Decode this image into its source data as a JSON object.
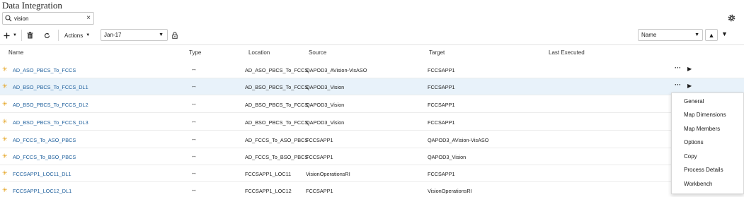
{
  "page": {
    "title": "Data Integration"
  },
  "search": {
    "value": "vision",
    "clear_label": "×"
  },
  "toolbar": {
    "actions_label": "Actions",
    "period_value": "Jan-17",
    "sort_value": "Name"
  },
  "columns": {
    "name": "Name",
    "type": "Type",
    "location": "Location",
    "source": "Source",
    "target": "Target",
    "last_executed": "Last Executed"
  },
  "rows": [
    {
      "name": "AD_ASO_PBCS_To_FCCS",
      "type": "↔",
      "location": "AD_ASO_PBCS_To_FCCS",
      "source": "QAPOD3_AVision-VisASO",
      "target": "FCCSAPP1",
      "last_executed": ""
    },
    {
      "name": "AD_BSO_PBCS_To_FCCS_DL1",
      "type": "↔",
      "location": "AD_BSO_PBCS_To_FCCS",
      "source": "QAPOD3_Vision",
      "target": "FCCSAPP1",
      "last_executed": ""
    },
    {
      "name": "AD_BSO_PBCS_To_FCCS_DL2",
      "type": "↔",
      "location": "AD_BSO_PBCS_To_FCCS",
      "source": "QAPOD3_Vision",
      "target": "FCCSAPP1",
      "last_executed": ""
    },
    {
      "name": "AD_BSO_PBCS_To_FCCS_DL3",
      "type": "↔",
      "location": "AD_BSO_PBCS_To_FCCS",
      "source": "QAPOD3_Vision",
      "target": "FCCSAPP1",
      "last_executed": ""
    },
    {
      "name": "AD_FCCS_To_ASO_PBCS",
      "type": "↔",
      "location": "AD_FCCS_To_ASO_PBCS",
      "source": "FCCSAPP1",
      "target": "QAPOD3_AVision-VisASO",
      "last_executed": ""
    },
    {
      "name": "AD_FCCS_To_BSO_PBCS",
      "type": "↔",
      "location": "AD_FCCS_To_BSO_PBCS",
      "source": "FCCSAPP1",
      "target": "QAPOD3_Vision",
      "last_executed": ""
    },
    {
      "name": "FCCSAPP1_LOC11_DL1",
      "type": "↔",
      "location": "FCCSAPP1_LOC11",
      "source": "VisionOperationsRI",
      "target": "FCCSAPP1",
      "last_executed": ""
    },
    {
      "name": "FCCSAPP1_LOC12_DL1",
      "type": "↔",
      "location": "FCCSAPP1_LOC12",
      "source": "FCCSAPP1",
      "target": "VisionOperationsRI",
      "last_executed": ""
    }
  ],
  "row_actions": {
    "more_label": "···",
    "run_label": "▶"
  },
  "context_menu": {
    "items": [
      "General",
      "Map Dimensions",
      "Map Members",
      "Options",
      "Copy",
      "Process Details",
      "Workbench"
    ]
  },
  "colors": {
    "link": "#1e5f9c",
    "star": "#e4a11b",
    "selected_row": "#e8f2fa"
  }
}
